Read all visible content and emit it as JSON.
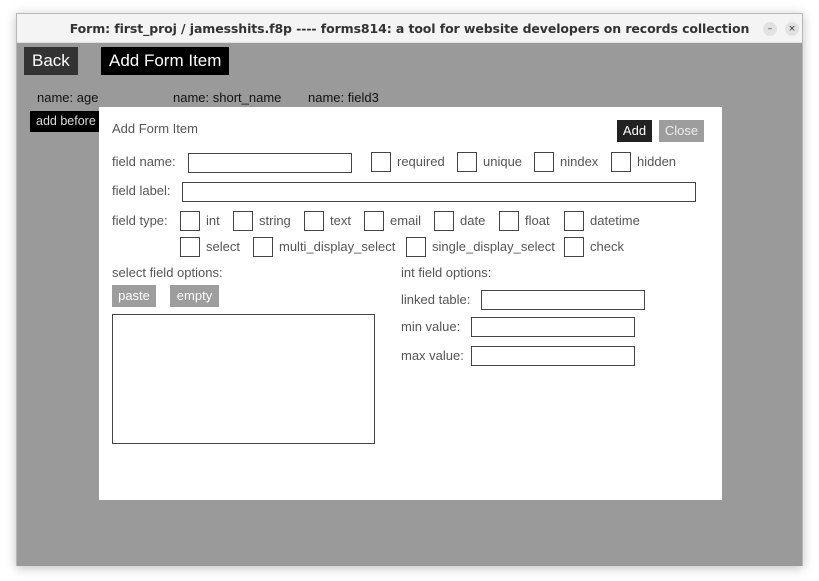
{
  "window": {
    "title": "Form: first_proj / jamesshits.f8p ---- forms814: a tool for website developers on records collection",
    "minimize_glyph": "–",
    "close_glyph": "×"
  },
  "toolbar": {
    "back_label": "Back",
    "add_form_item_label": "Add Form Item"
  },
  "form_fields": [
    {
      "label": "name: age"
    },
    {
      "label": "name: short_name"
    },
    {
      "label": "name: field3"
    }
  ],
  "add_before_label": "add before",
  "modal": {
    "title": "Add Form Item",
    "add_label": "Add",
    "close_label": "Close",
    "field_name_label": "field name:",
    "field_name_value": "",
    "flags": [
      "required",
      "unique",
      "nindex",
      "hidden"
    ],
    "field_label_label": "field label:",
    "field_label_value": "",
    "field_type_label": "field type:",
    "types_row1": [
      "int",
      "string",
      "text",
      "email",
      "date",
      "float",
      "datetime"
    ],
    "types_row2": [
      "select",
      "multi_display_select",
      "single_display_select",
      "check"
    ],
    "select_options_label": "select field options:",
    "paste_label": "paste",
    "empty_label": "empty",
    "int_options_label": "int field options:",
    "linked_table_label": "linked table:",
    "min_value_label": "min value:",
    "max_value_label": "max value:"
  }
}
